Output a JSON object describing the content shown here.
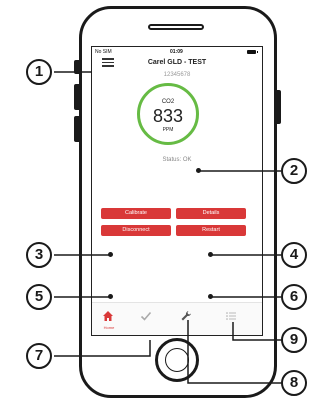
{
  "status_bar": {
    "carrier": "No SIM",
    "time": "01:09"
  },
  "header": {
    "title": "Carel GLD - TEST",
    "serial": "12345678",
    "menu_icon": "hamburger-menu-icon"
  },
  "reading": {
    "gas": "CO2",
    "value": "833",
    "unit": "PPM",
    "status": "Status: OK",
    "ring_color": "#66bb44"
  },
  "actions": {
    "calibrate": "Calibrate",
    "details": "Details",
    "disconnect": "Disconnect",
    "restart": "Restart",
    "color": "#d93838"
  },
  "tab_bar": {
    "home_label": "Home",
    "icons": [
      "home-icon",
      "checkmark-icon",
      "wrench-icon",
      "list-icon"
    ]
  },
  "callouts": [
    "1",
    "2",
    "3",
    "4",
    "5",
    "6",
    "7",
    "8",
    "9"
  ]
}
